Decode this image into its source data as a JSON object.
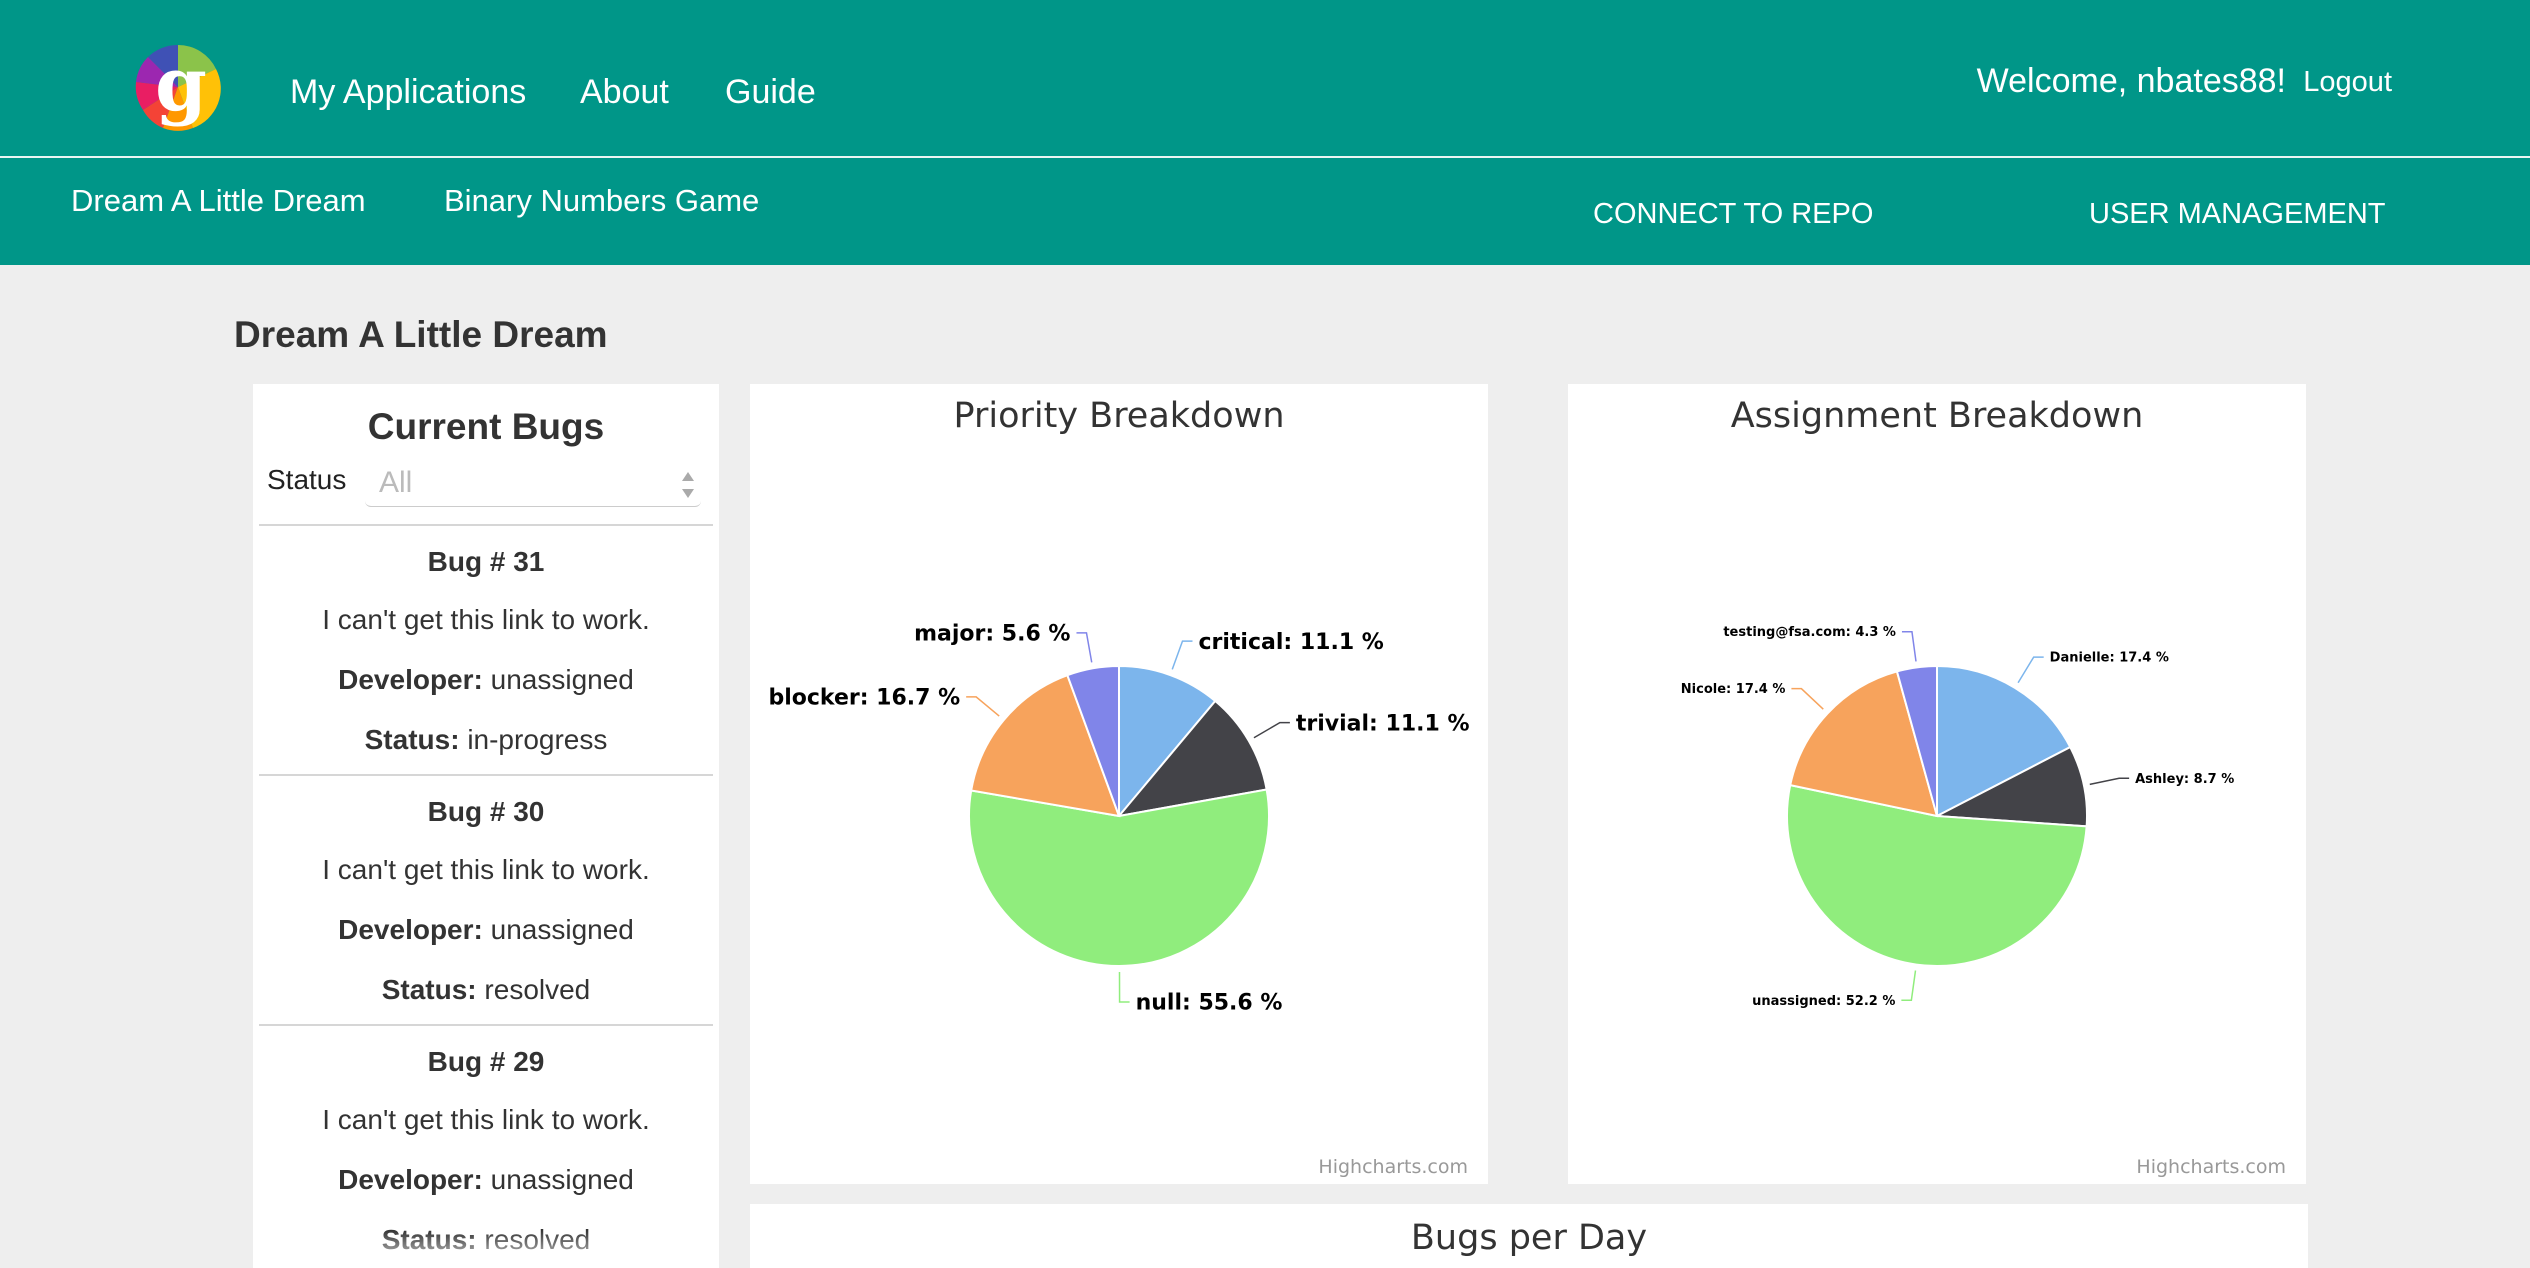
{
  "header": {
    "nav": [
      "My Applications",
      "About",
      "Guide"
    ],
    "welcome": "Welcome, nbates88!",
    "logout": "Logout"
  },
  "subnav": {
    "apps": [
      "Dream A Little Dream",
      "Binary Numbers Game"
    ],
    "connect_repo": "CONNECT TO REPO",
    "user_management": "USER MANAGEMENT"
  },
  "page": {
    "title": "Dream A Little Dream"
  },
  "bugs_panel": {
    "title": "Current Bugs",
    "status_label": "Status",
    "status_value": "All",
    "developer_label": "Developer:",
    "status_item_label": "Status:",
    "items": [
      {
        "number": "Bug # 31",
        "description": "I can't get this link to work.",
        "developer": "unassigned",
        "status": "in-progress"
      },
      {
        "number": "Bug # 30",
        "description": "I can't get this link to work.",
        "developer": "unassigned",
        "status": "resolved"
      },
      {
        "number": "Bug # 29",
        "description": "I can't get this link to work.",
        "developer": "unassigned",
        "status": "resolved"
      }
    ]
  },
  "charts_credit": "Highcharts.com",
  "bugs_per_day_title": "Bugs per Day",
  "chart_data": [
    {
      "type": "pie",
      "title": "Priority Breakdown",
      "series": [
        {
          "name": "critical",
          "value": 11.1,
          "label": "critical: 11.1 %",
          "color": "#7cb5ec"
        },
        {
          "name": "trivial",
          "value": 11.1,
          "label": "trivial: 11.1 %",
          "color": "#434348"
        },
        {
          "name": "null",
          "value": 55.6,
          "label": "null: 55.6 %",
          "color": "#90ed7d"
        },
        {
          "name": "blocker",
          "value": 16.7,
          "label": "blocker: 16.7 %",
          "color": "#f7a35c"
        },
        {
          "name": "major",
          "value": 5.6,
          "label": "major: 5.6 %",
          "color": "#8085e9"
        }
      ]
    },
    {
      "type": "pie",
      "title": "Assignment Breakdown",
      "series": [
        {
          "name": "Danielle",
          "value": 17.4,
          "label": "Danielle: 17.4 %",
          "color": "#7cb5ec"
        },
        {
          "name": "Ashley",
          "value": 8.7,
          "label": "Ashley: 8.7 %",
          "color": "#434348"
        },
        {
          "name": "unassigned",
          "value": 52.2,
          "label": "unassigned: 52.2 %",
          "color": "#90ed7d"
        },
        {
          "name": "Nicole",
          "value": 17.4,
          "label": "Nicole: 17.4 %",
          "color": "#f7a35c"
        },
        {
          "name": "testing@fsa.com",
          "value": 4.3,
          "label": "testing@fsa.com: 4.3 %",
          "color": "#8085e9"
        }
      ]
    }
  ]
}
